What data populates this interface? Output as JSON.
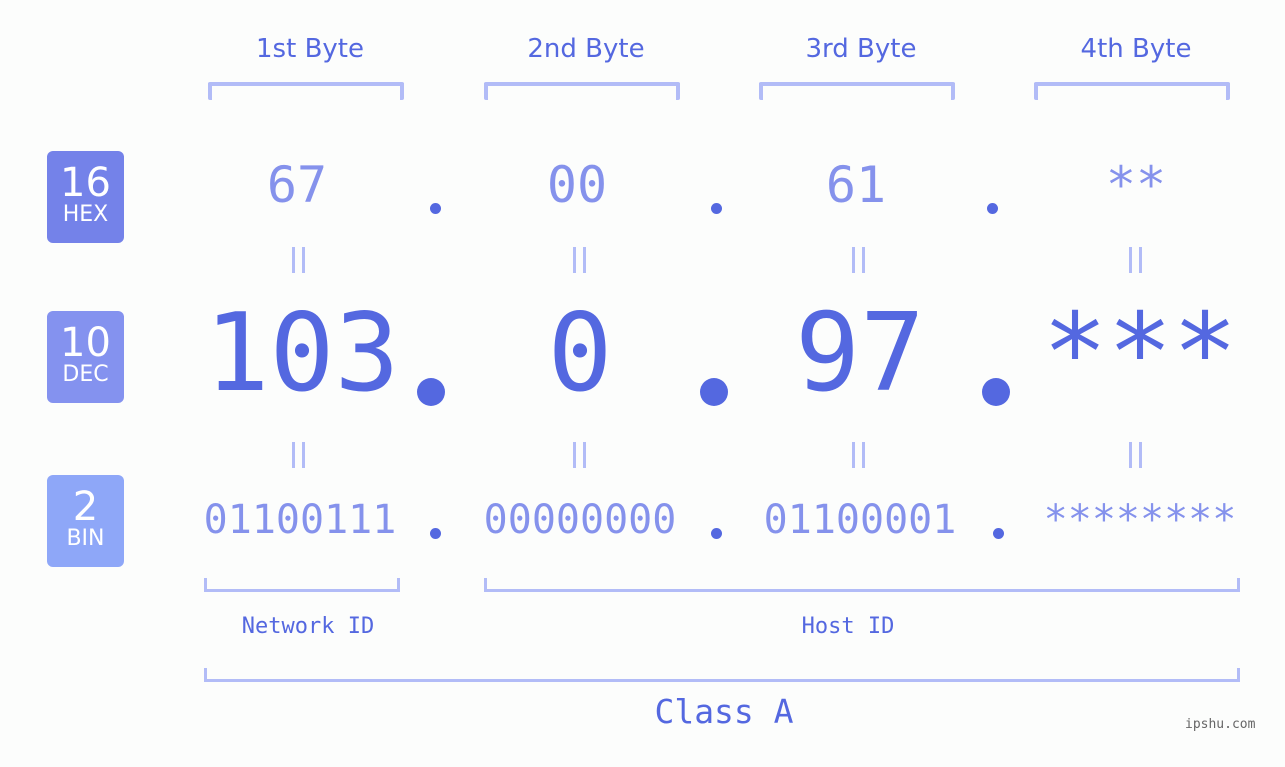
{
  "byte_headers": [
    "1st Byte",
    "2nd Byte",
    "3rd Byte",
    "4th Byte"
  ],
  "bases": [
    {
      "number": "16",
      "label": "HEX",
      "color": "#7482e9"
    },
    {
      "number": "10",
      "label": "DEC",
      "color": "#8492ef"
    },
    {
      "number": "2",
      "label": "BIN",
      "color": "#8ea7f8"
    }
  ],
  "hex_values": [
    "67",
    "00",
    "61",
    "**"
  ],
  "dec_values": [
    "103",
    "0",
    "97",
    "***"
  ],
  "bin_values": [
    "01100111",
    "00000000",
    "01100001",
    "********"
  ],
  "separator": ".",
  "equals_sign": "=",
  "network_label": "Network ID",
  "host_label": "Host ID",
  "class_label": "Class A",
  "watermark": "ipshu.com",
  "colors": {
    "accent": "#5468e0",
    "light_accent": "#8592ec",
    "bracket": "#b2bcf7",
    "background": "#fcfdfc"
  }
}
